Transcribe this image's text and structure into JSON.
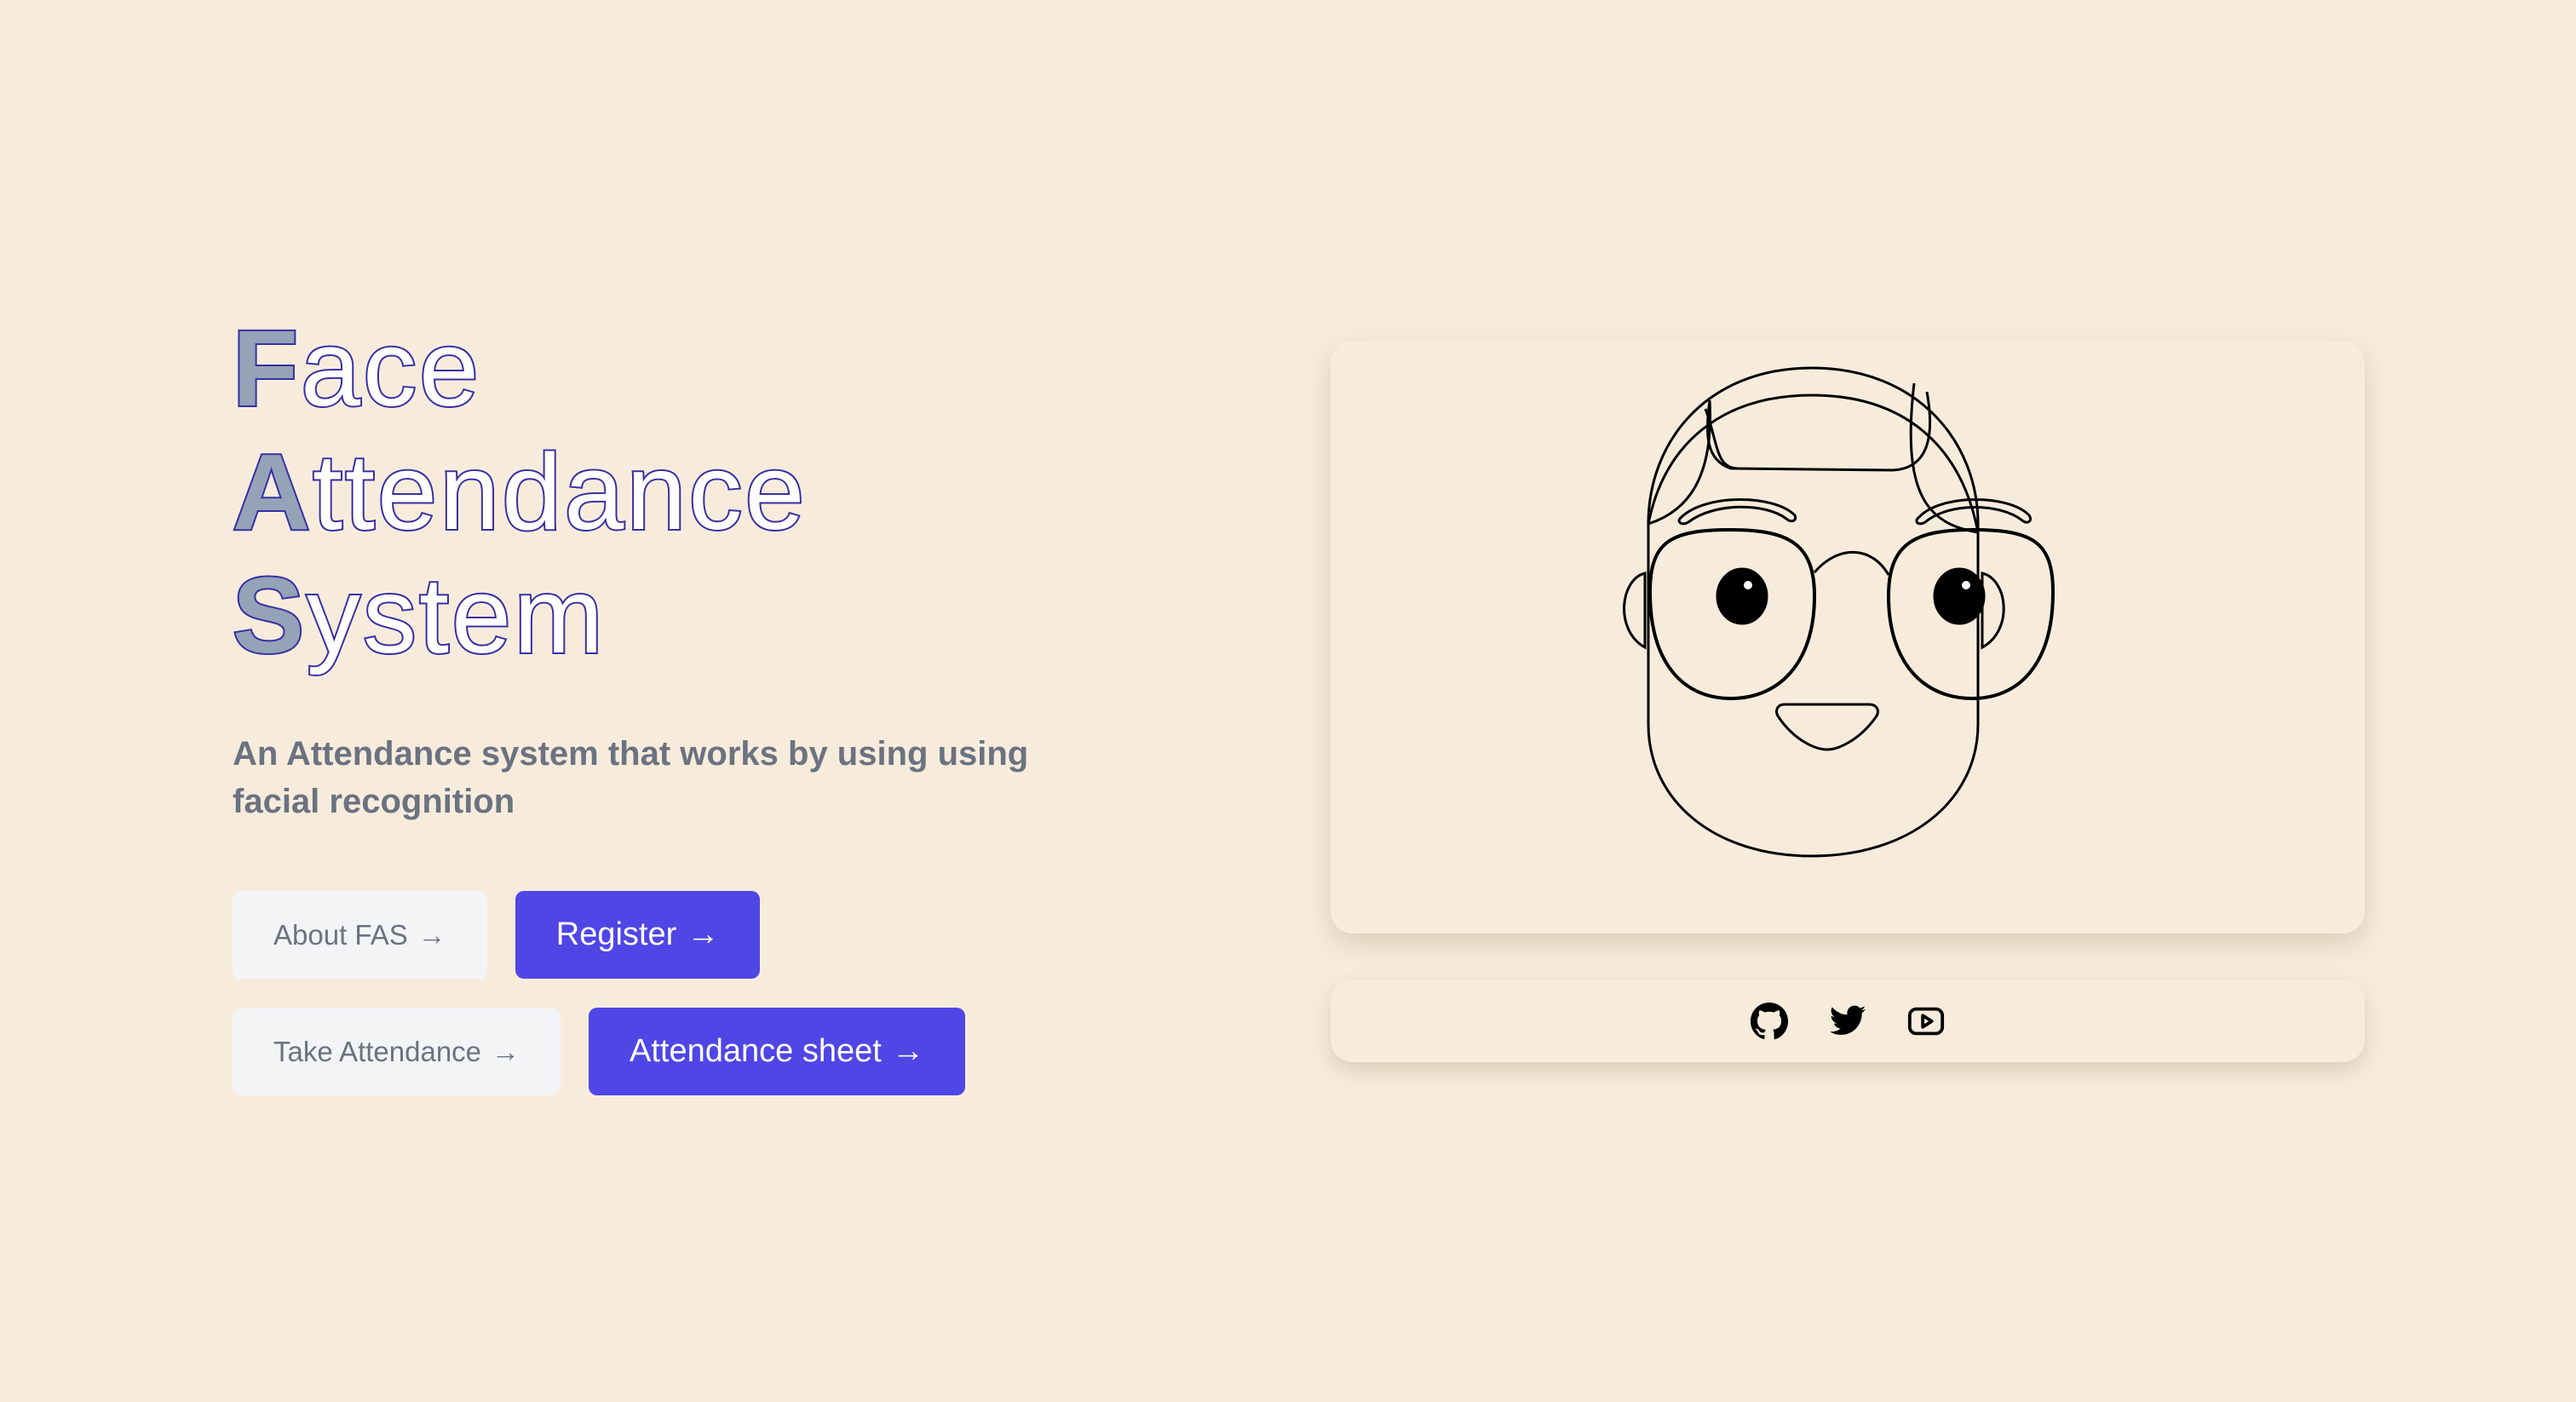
{
  "hero": {
    "title_lines": [
      {
        "initial": "F",
        "rest": "ace"
      },
      {
        "initial": "A",
        "rest": "ttendance"
      },
      {
        "initial": "S",
        "rest": "ystem"
      }
    ],
    "subtitle": "An Attendance system that works by using using facial recognition"
  },
  "buttons": {
    "about": {
      "label": "About FAS",
      "arrow": "→"
    },
    "register": {
      "label": "Register",
      "arrow": "→"
    },
    "take_attendance": {
      "label": "Take Attendance",
      "arrow": "→"
    },
    "attendance_sheet": {
      "label": "Attendance sheet",
      "arrow": "→"
    }
  },
  "illustration": {
    "subject": "cartoon-face-with-glasses"
  },
  "social": {
    "items": [
      {
        "name": "GitHub",
        "icon": "github-icon"
      },
      {
        "name": "Twitter",
        "icon": "twitter-icon"
      },
      {
        "name": "YouTube",
        "icon": "youtube-icon"
      }
    ]
  },
  "colors": {
    "background": "#F7ECDC",
    "primary": "#4F46E5",
    "title_stroke": "#3730A3",
    "title_initial_fill": "#94A3B8",
    "subtitle": "#6B7280",
    "light_button": "#F3F4F6"
  }
}
